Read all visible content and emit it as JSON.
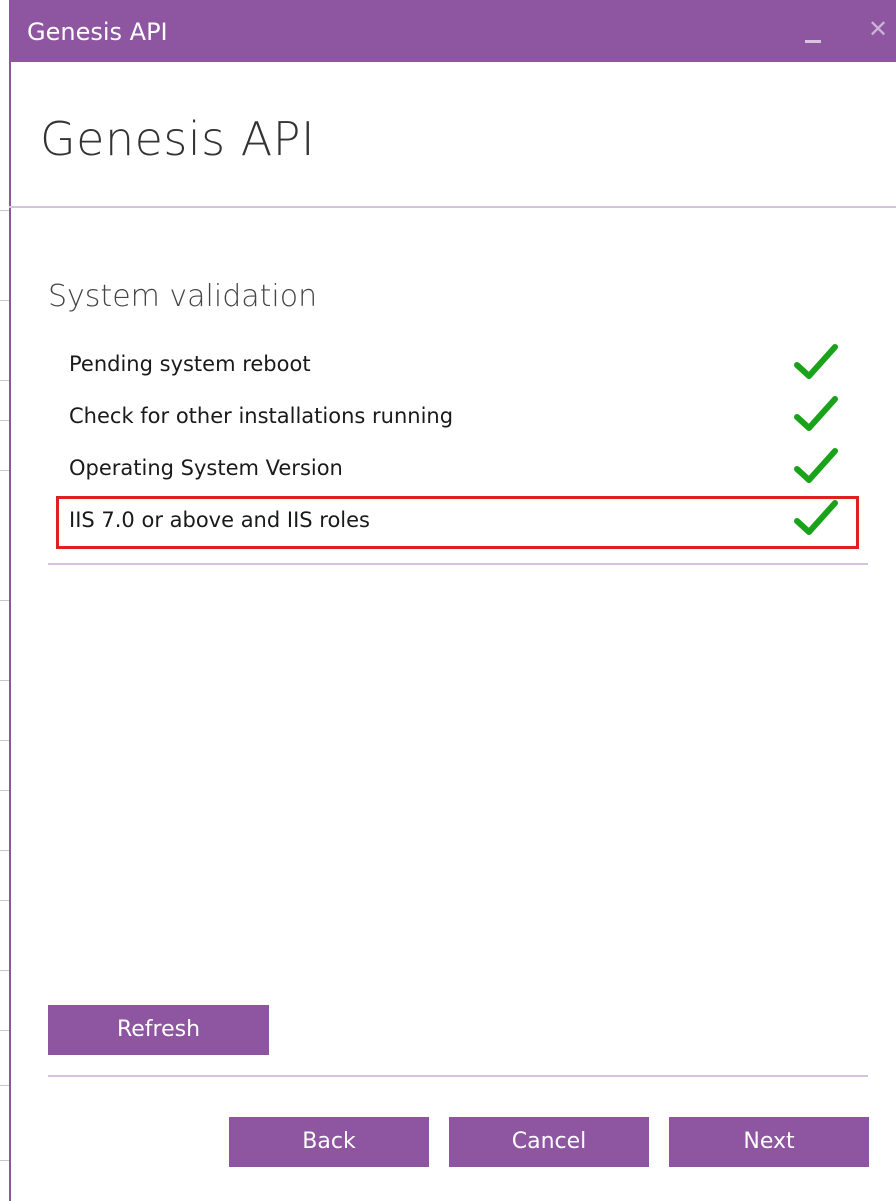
{
  "window": {
    "title": "Genesis API",
    "minimize_icon": "minimize-icon",
    "close_icon": "close-icon",
    "close_glyph": "✕",
    "accent_color": "#8e55a0"
  },
  "header": {
    "title": "Genesis API"
  },
  "validation": {
    "title": "System validation",
    "items": [
      {
        "label": "Pending system reboot",
        "status": "passed",
        "icon": "checkmark-icon"
      },
      {
        "label": "Check for other installations running",
        "status": "passed",
        "icon": "checkmark-icon"
      },
      {
        "label": "Operating System Version",
        "status": "passed",
        "icon": "checkmark-icon"
      },
      {
        "label": "IIS 7.0 or above and IIS roles",
        "status": "passed",
        "icon": "checkmark-icon",
        "highlighted": true
      }
    ],
    "check_color": "#1aa31a",
    "highlight_color": "#e02020"
  },
  "buttons": {
    "refresh": "Refresh",
    "back": "Back",
    "cancel": "Cancel",
    "next": "Next"
  }
}
